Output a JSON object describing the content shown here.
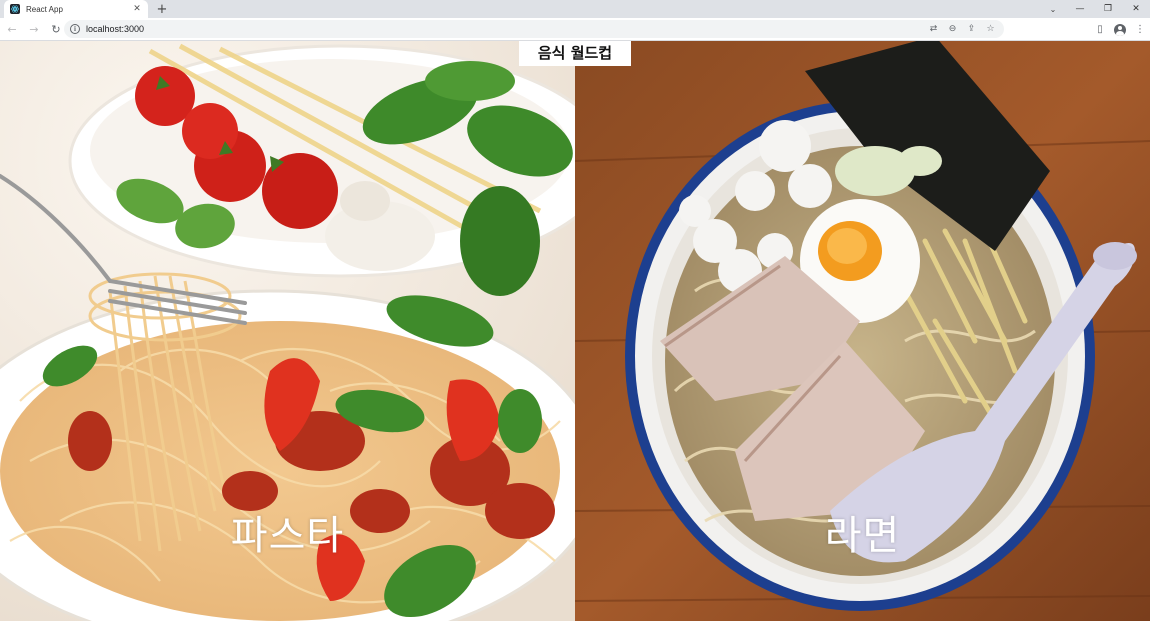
{
  "browser": {
    "tab_title": "React App",
    "new_tab": "+",
    "url": "localhost:3000"
  },
  "app": {
    "title": "음식 월드컵"
  },
  "matchup": [
    {
      "name": "파스타"
    },
    {
      "name": "라면"
    }
  ]
}
